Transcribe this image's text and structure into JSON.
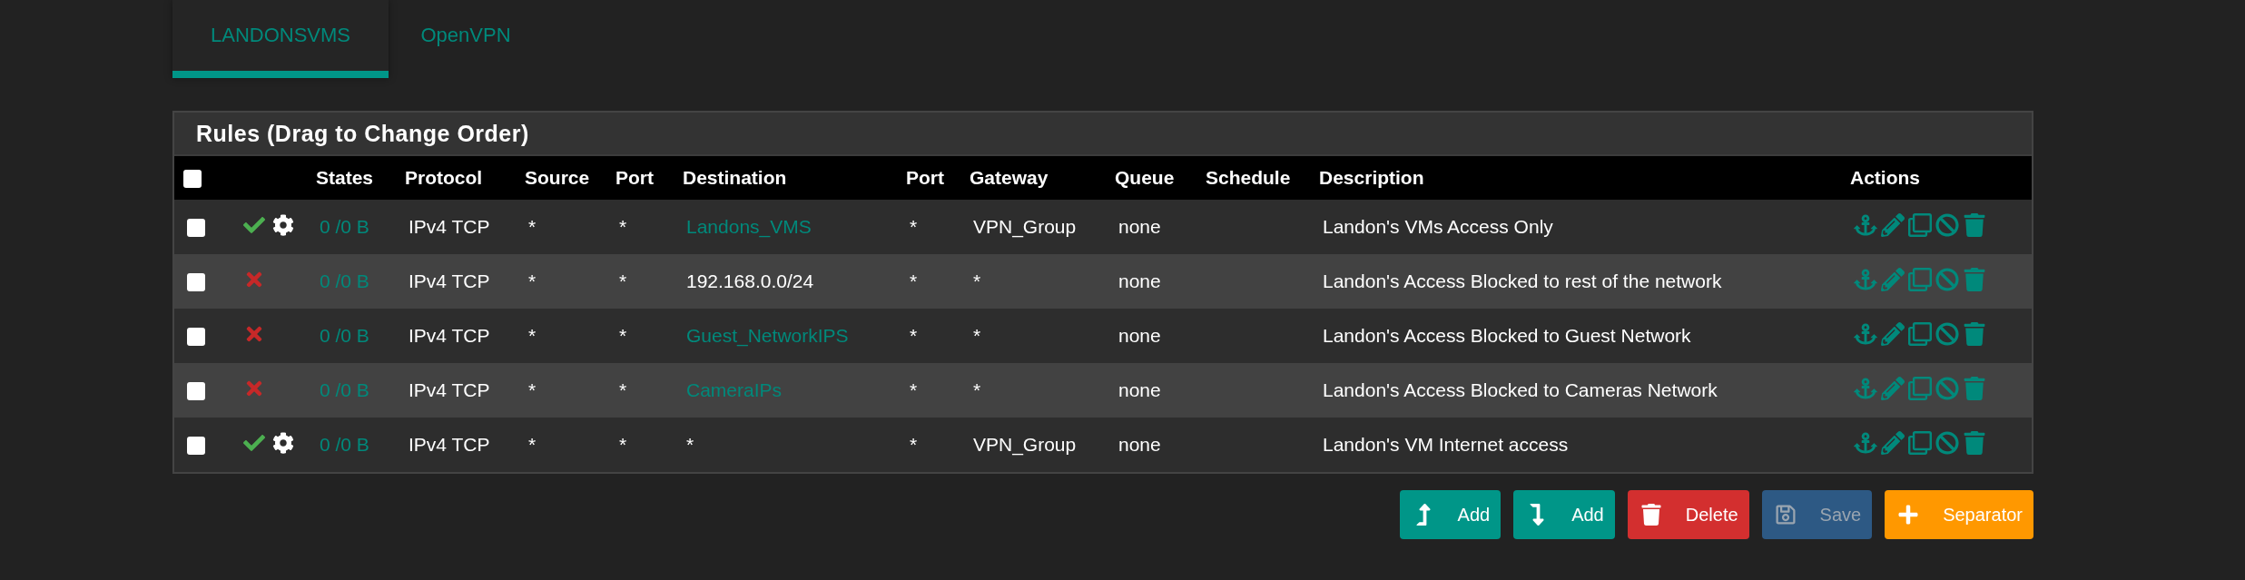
{
  "tabs": [
    {
      "label": "LANDONSVMS",
      "selected": true
    },
    {
      "label": "OpenVPN",
      "selected": false
    }
  ],
  "panel": {
    "title": "Rules (Drag to Change Order)",
    "select_all": {
      "checked": false
    },
    "columns": [
      "States",
      "Protocol",
      "Source",
      "Port",
      "Destination",
      "Port",
      "Gateway",
      "Queue",
      "Schedule",
      "Description",
      "Actions"
    ],
    "rows": [
      {
        "checked": false,
        "kind": "pass",
        "advanced": true,
        "states": "0 /0 B",
        "protocol": "IPv4 TCP",
        "source": "*",
        "source_port": "*",
        "destination": "Landons_VMS",
        "destination_is_alias": true,
        "destination_port": "*",
        "gateway": "VPN_Group",
        "queue": "none",
        "description": "Landon's VMs Access Only"
      },
      {
        "checked": false,
        "kind": "block",
        "advanced": false,
        "states": "0 /0 B",
        "protocol": "IPv4 TCP",
        "source": "*",
        "source_port": "*",
        "destination": "192.168.0.0/24",
        "destination_is_alias": false,
        "destination_port": "*",
        "gateway": "*",
        "queue": "none",
        "description": "Landon's Access Blocked to rest of the network"
      },
      {
        "checked": false,
        "kind": "block",
        "advanced": false,
        "states": "0 /0 B",
        "protocol": "IPv4 TCP",
        "source": "*",
        "source_port": "*",
        "destination": "Guest_NetworkIPS",
        "destination_is_alias": true,
        "destination_port": "*",
        "gateway": "*",
        "queue": "none",
        "description": "Landon's Access Blocked to Guest Network"
      },
      {
        "checked": false,
        "kind": "block",
        "advanced": false,
        "states": "0 /0 B",
        "protocol": "IPv4 TCP",
        "source": "*",
        "source_port": "*",
        "destination": "CameraIPs",
        "destination_is_alias": true,
        "destination_port": "*",
        "gateway": "*",
        "queue": "none",
        "description": "Landon's Access Blocked to Cameras Network"
      },
      {
        "checked": false,
        "kind": "pass",
        "advanced": true,
        "states": "0 /0 B",
        "protocol": "IPv4 TCP",
        "source": "*",
        "source_port": "*",
        "destination": "*",
        "destination_is_alias": false,
        "destination_port": "*",
        "gateway": "VPN_Group",
        "queue": "none",
        "description": "Landon's VM Internet access"
      }
    ]
  },
  "buttons": [
    {
      "kind": "add-top",
      "label": "Add",
      "disabled": false
    },
    {
      "kind": "add-bottom",
      "label": "Add",
      "disabled": false
    },
    {
      "kind": "delete",
      "label": "Delete",
      "disabled": false
    },
    {
      "kind": "save",
      "label": "Save",
      "disabled": true
    },
    {
      "kind": "separator",
      "label": "Separator",
      "disabled": false
    }
  ]
}
